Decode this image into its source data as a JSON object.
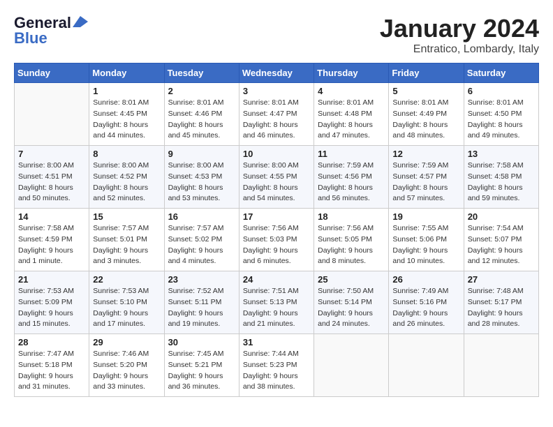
{
  "logo": {
    "line1": "General",
    "line2": "Blue"
  },
  "title": "January 2024",
  "subtitle": "Entratico, Lombardy, Italy",
  "header": {
    "accent_color": "#3a6bc4"
  },
  "days_of_week": [
    "Sunday",
    "Monday",
    "Tuesday",
    "Wednesday",
    "Thursday",
    "Friday",
    "Saturday"
  ],
  "weeks": [
    [
      {
        "day": "",
        "info": ""
      },
      {
        "day": "1",
        "info": "Sunrise: 8:01 AM\nSunset: 4:45 PM\nDaylight: 8 hours\nand 44 minutes."
      },
      {
        "day": "2",
        "info": "Sunrise: 8:01 AM\nSunset: 4:46 PM\nDaylight: 8 hours\nand 45 minutes."
      },
      {
        "day": "3",
        "info": "Sunrise: 8:01 AM\nSunset: 4:47 PM\nDaylight: 8 hours\nand 46 minutes."
      },
      {
        "day": "4",
        "info": "Sunrise: 8:01 AM\nSunset: 4:48 PM\nDaylight: 8 hours\nand 47 minutes."
      },
      {
        "day": "5",
        "info": "Sunrise: 8:01 AM\nSunset: 4:49 PM\nDaylight: 8 hours\nand 48 minutes."
      },
      {
        "day": "6",
        "info": "Sunrise: 8:01 AM\nSunset: 4:50 PM\nDaylight: 8 hours\nand 49 minutes."
      }
    ],
    [
      {
        "day": "7",
        "info": "Sunrise: 8:00 AM\nSunset: 4:51 PM\nDaylight: 8 hours\nand 50 minutes."
      },
      {
        "day": "8",
        "info": "Sunrise: 8:00 AM\nSunset: 4:52 PM\nDaylight: 8 hours\nand 52 minutes."
      },
      {
        "day": "9",
        "info": "Sunrise: 8:00 AM\nSunset: 4:53 PM\nDaylight: 8 hours\nand 53 minutes."
      },
      {
        "day": "10",
        "info": "Sunrise: 8:00 AM\nSunset: 4:55 PM\nDaylight: 8 hours\nand 54 minutes."
      },
      {
        "day": "11",
        "info": "Sunrise: 7:59 AM\nSunset: 4:56 PM\nDaylight: 8 hours\nand 56 minutes."
      },
      {
        "day": "12",
        "info": "Sunrise: 7:59 AM\nSunset: 4:57 PM\nDaylight: 8 hours\nand 57 minutes."
      },
      {
        "day": "13",
        "info": "Sunrise: 7:58 AM\nSunset: 4:58 PM\nDaylight: 8 hours\nand 59 minutes."
      }
    ],
    [
      {
        "day": "14",
        "info": "Sunrise: 7:58 AM\nSunset: 4:59 PM\nDaylight: 9 hours\nand 1 minute."
      },
      {
        "day": "15",
        "info": "Sunrise: 7:57 AM\nSunset: 5:01 PM\nDaylight: 9 hours\nand 3 minutes."
      },
      {
        "day": "16",
        "info": "Sunrise: 7:57 AM\nSunset: 5:02 PM\nDaylight: 9 hours\nand 4 minutes."
      },
      {
        "day": "17",
        "info": "Sunrise: 7:56 AM\nSunset: 5:03 PM\nDaylight: 9 hours\nand 6 minutes."
      },
      {
        "day": "18",
        "info": "Sunrise: 7:56 AM\nSunset: 5:05 PM\nDaylight: 9 hours\nand 8 minutes."
      },
      {
        "day": "19",
        "info": "Sunrise: 7:55 AM\nSunset: 5:06 PM\nDaylight: 9 hours\nand 10 minutes."
      },
      {
        "day": "20",
        "info": "Sunrise: 7:54 AM\nSunset: 5:07 PM\nDaylight: 9 hours\nand 12 minutes."
      }
    ],
    [
      {
        "day": "21",
        "info": "Sunrise: 7:53 AM\nSunset: 5:09 PM\nDaylight: 9 hours\nand 15 minutes."
      },
      {
        "day": "22",
        "info": "Sunrise: 7:53 AM\nSunset: 5:10 PM\nDaylight: 9 hours\nand 17 minutes."
      },
      {
        "day": "23",
        "info": "Sunrise: 7:52 AM\nSunset: 5:11 PM\nDaylight: 9 hours\nand 19 minutes."
      },
      {
        "day": "24",
        "info": "Sunrise: 7:51 AM\nSunset: 5:13 PM\nDaylight: 9 hours\nand 21 minutes."
      },
      {
        "day": "25",
        "info": "Sunrise: 7:50 AM\nSunset: 5:14 PM\nDaylight: 9 hours\nand 24 minutes."
      },
      {
        "day": "26",
        "info": "Sunrise: 7:49 AM\nSunset: 5:16 PM\nDaylight: 9 hours\nand 26 minutes."
      },
      {
        "day": "27",
        "info": "Sunrise: 7:48 AM\nSunset: 5:17 PM\nDaylight: 9 hours\nand 28 minutes."
      }
    ],
    [
      {
        "day": "28",
        "info": "Sunrise: 7:47 AM\nSunset: 5:18 PM\nDaylight: 9 hours\nand 31 minutes."
      },
      {
        "day": "29",
        "info": "Sunrise: 7:46 AM\nSunset: 5:20 PM\nDaylight: 9 hours\nand 33 minutes."
      },
      {
        "day": "30",
        "info": "Sunrise: 7:45 AM\nSunset: 5:21 PM\nDaylight: 9 hours\nand 36 minutes."
      },
      {
        "day": "31",
        "info": "Sunrise: 7:44 AM\nSunset: 5:23 PM\nDaylight: 9 hours\nand 38 minutes."
      },
      {
        "day": "",
        "info": ""
      },
      {
        "day": "",
        "info": ""
      },
      {
        "day": "",
        "info": ""
      }
    ]
  ]
}
